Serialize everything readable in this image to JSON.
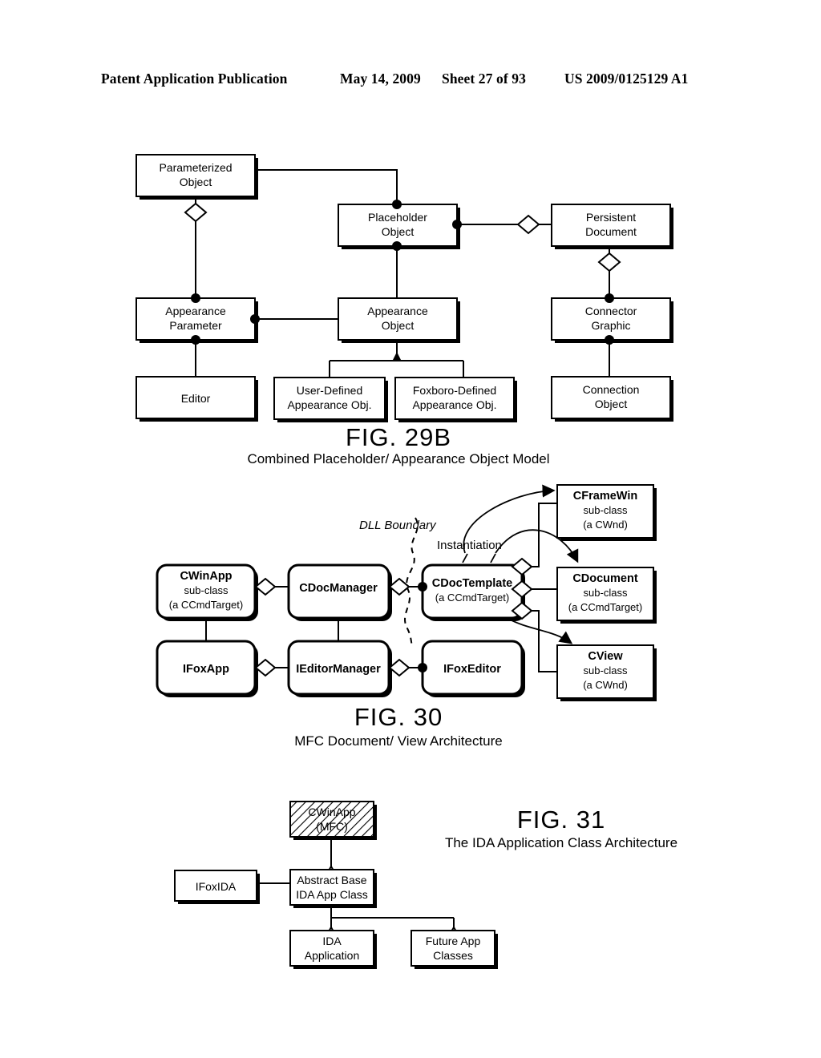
{
  "header": {
    "publication": "Patent Application Publication",
    "date": "May 14, 2009",
    "sheet": "Sheet 27 of 93",
    "number": "US 2009/0125129 A1"
  },
  "figures": [
    {
      "id": "fig29b",
      "title": "FIG. 29B",
      "subtitle": "Combined Placeholder/ Appearance Object Model",
      "boxes": {
        "parameterized_object": {
          "line1": "Parameterized",
          "line2": "Object"
        },
        "placeholder_object": {
          "line1": "Placeholder",
          "line2": "Object"
        },
        "persistent_document": {
          "line1": "Persistent",
          "line2": "Document"
        },
        "appearance_parameter": {
          "line1": "Appearance",
          "line2": "Parameter"
        },
        "appearance_object": {
          "line1": "Appearance",
          "line2": "Object"
        },
        "connector_graphic": {
          "line1": "Connector",
          "line2": "Graphic"
        },
        "editor": {
          "line1": "Editor",
          "line2": ""
        },
        "user_defined_appearance_obj": {
          "line1": "User-Defined",
          "line2": "Appearance Obj."
        },
        "foxboro_defined_appearance_obj": {
          "line1": "Foxboro-Defined",
          "line2": "Appearance Obj."
        },
        "connection_object": {
          "line1": "Connection",
          "line2": "Object"
        }
      }
    },
    {
      "id": "fig30",
      "title": "FIG. 30",
      "subtitle": "MFC Document/ View Architecture",
      "annotations": {
        "dll_boundary": "DLL Boundary",
        "instantiation": "Instantiation"
      },
      "boxes": {
        "cwinapp": {
          "line1": "CWinApp",
          "line2": "sub-class",
          "line3": "(a CCmdTarget)"
        },
        "cdocmanager": {
          "line1": "CDocManager",
          "line2": "",
          "line3": ""
        },
        "cdoctemplate": {
          "line1": "CDocTemplate",
          "line2": "(a CCmdTarget)",
          "line3": ""
        },
        "cframewin": {
          "line1": "CFrameWin",
          "line2": "sub-class",
          "line3": "(a CWnd)"
        },
        "cdocument": {
          "line1": "CDocument",
          "line2": "sub-class",
          "line3": "(a CCmdTarget)"
        },
        "cview": {
          "line1": "CView",
          "line2": "sub-class",
          "line3": "(a CWnd)"
        },
        "ifoxapp": {
          "line1": "IFoxApp",
          "line2": "",
          "line3": ""
        },
        "ieditormanager": {
          "line1": "IEditorManager",
          "line2": "",
          "line3": ""
        },
        "ifoxeditor": {
          "line1": "IFoxEditor",
          "line2": "",
          "line3": ""
        }
      }
    },
    {
      "id": "fig31",
      "title": "FIG. 31",
      "subtitle": "The IDA Application Class Architecture",
      "boxes": {
        "cwinapp_mfc": {
          "line1": "CWinApp",
          "line2": "(MFC)"
        },
        "ifoxida": {
          "line1": "IFoxIDA",
          "line2": ""
        },
        "abstract_base_ida_app_class": {
          "line1": "Abstract Base",
          "line2": "IDA App Class"
        },
        "ida_application": {
          "line1": "IDA",
          "line2": "Application"
        },
        "future_app_classes": {
          "line1": "Future App",
          "line2": "Classes"
        }
      }
    }
  ]
}
